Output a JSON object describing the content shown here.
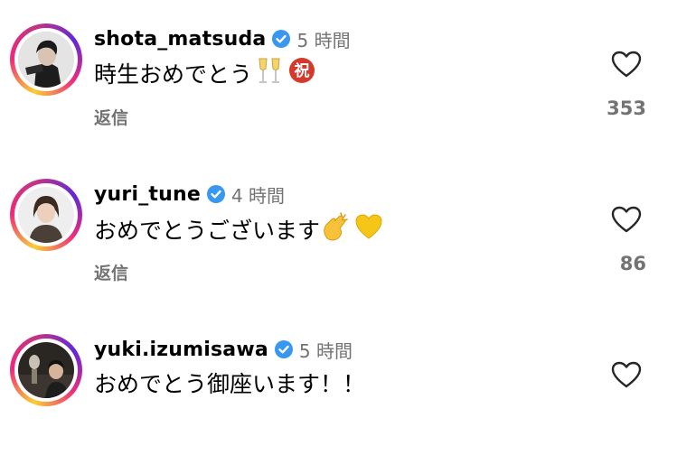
{
  "comments": [
    {
      "username": "shota_matsuda",
      "time": "5 時間",
      "text": "時生おめでとう",
      "emojis": [
        "clinking-glasses-icon",
        "congratulations-ideograph-icon"
      ],
      "reply_label": "返信",
      "likes": "353",
      "verified": true
    },
    {
      "username": "yuri_tune",
      "time": "4 時間",
      "text": "おめでとうございます",
      "emojis": [
        "clapping-hands-icon",
        "yellow-heart-icon"
      ],
      "reply_label": "返信",
      "likes": "86",
      "verified": true
    },
    {
      "username": "yuki.izumisawa",
      "time": "5 時間",
      "text": "おめでとう御座います！！",
      "emojis": [],
      "verified": true
    }
  ],
  "colors": {
    "verified": "#3897f0",
    "meta_gray": "#737373",
    "story_ring": [
      "#f9ce34",
      "#ee2a7b",
      "#6228d7"
    ]
  },
  "emoji_glyphs": {
    "congratulations": "祝"
  }
}
